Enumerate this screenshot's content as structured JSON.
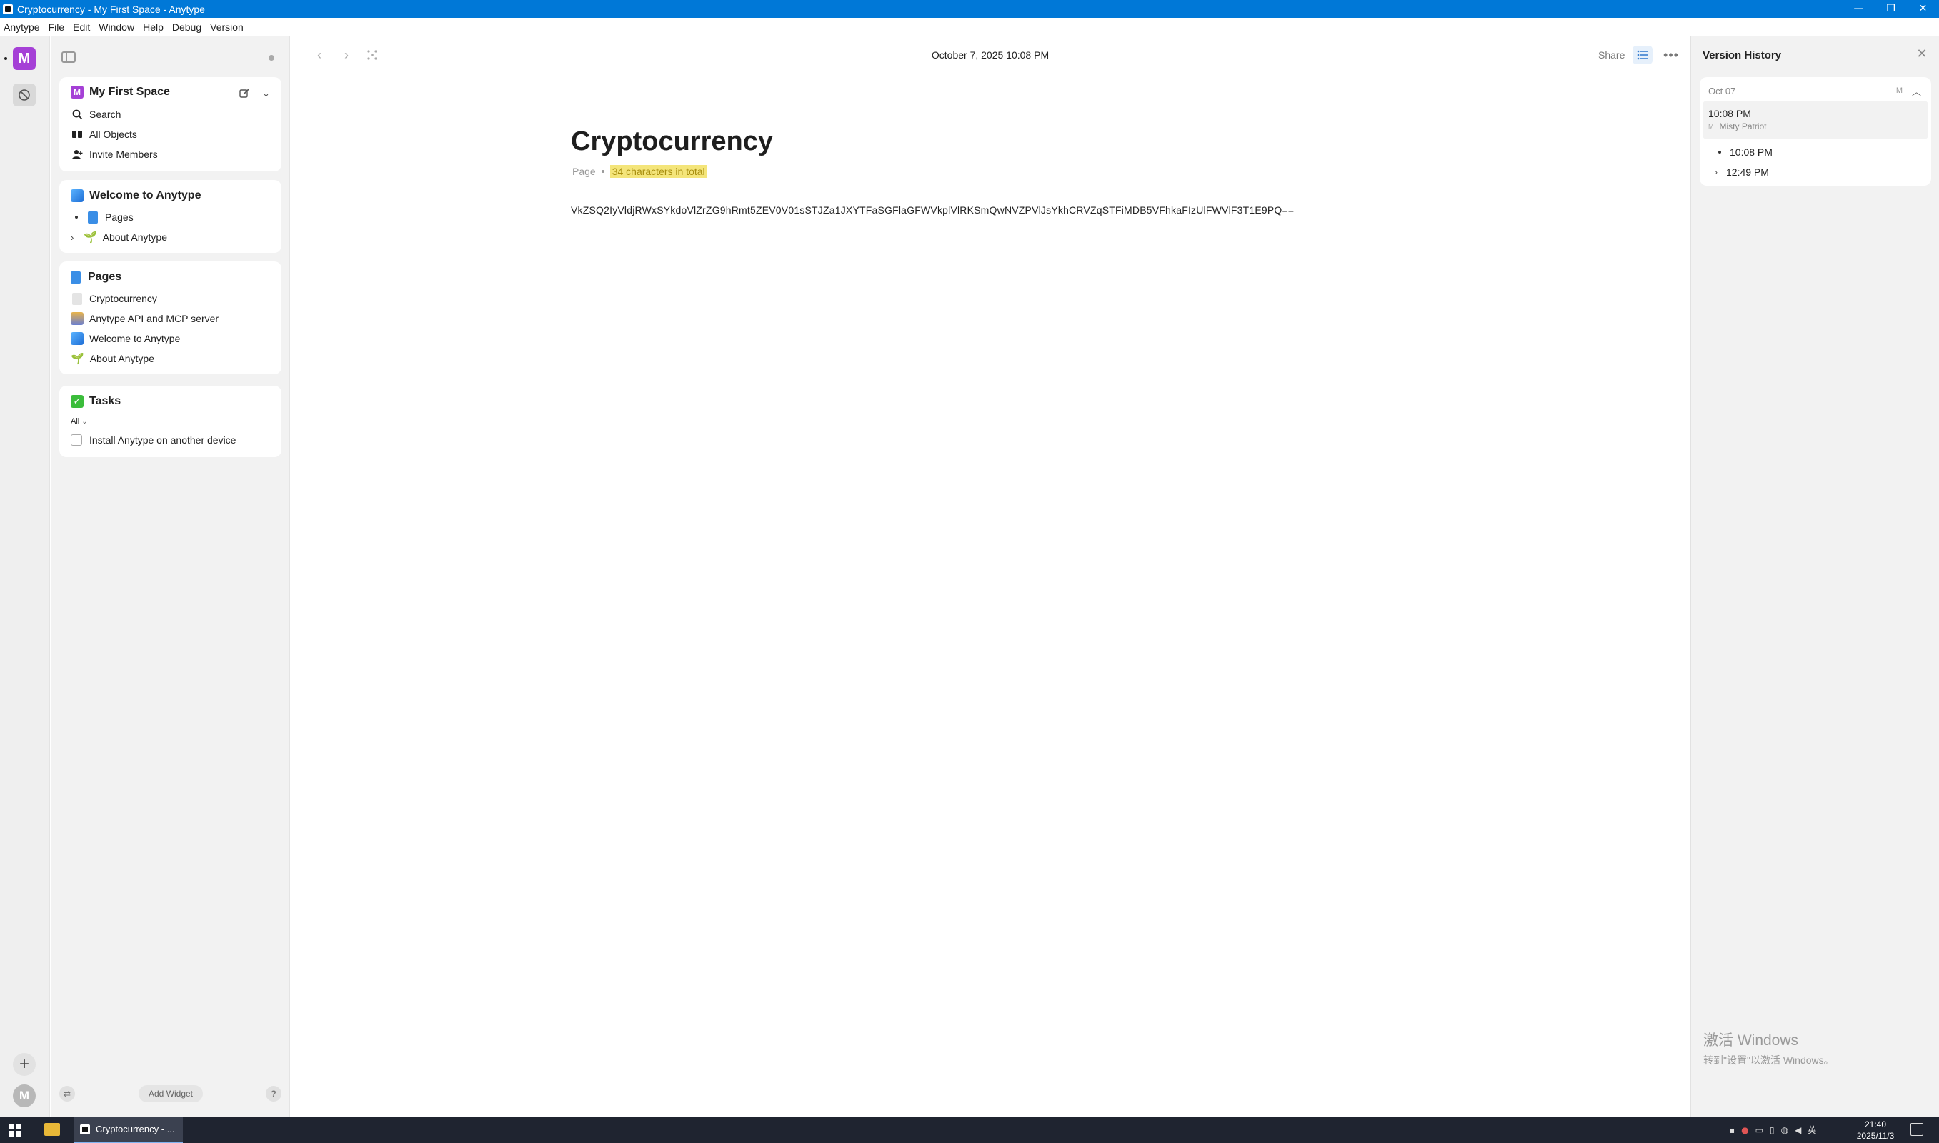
{
  "window": {
    "title": "Cryptocurrency - My First Space - Anytype",
    "controls": {
      "minimize": "—",
      "restore": "❐",
      "close": "✕"
    }
  },
  "menu": [
    "Anytype",
    "File",
    "Edit",
    "Window",
    "Help",
    "Debug",
    "Version"
  ],
  "rail": {
    "space_initial": "M",
    "profile_initial": "M",
    "add": "+",
    "accent": "#a540d6"
  },
  "sidebar": {
    "space": {
      "initial": "M",
      "name": "My First Space",
      "items": [
        {
          "icon": "search-icon",
          "label": "Search"
        },
        {
          "icon": "all-objects-icon",
          "label": "All Objects"
        },
        {
          "icon": "invite-icon",
          "label": "Invite Members"
        }
      ]
    },
    "welcome_widget": {
      "title": "Welcome to Anytype",
      "items": [
        {
          "label": "Pages",
          "expander": "bullet"
        },
        {
          "label": "About Anytype",
          "expander": "chevron"
        }
      ]
    },
    "pages_widget": {
      "title": "Pages",
      "items": [
        {
          "label": "Cryptocurrency",
          "icon": "blank-page-icon"
        },
        {
          "label": "Anytype API and MCP server",
          "icon": "people-icon"
        },
        {
          "label": "Welcome to Anytype",
          "icon": "welcome-icon"
        },
        {
          "label": "About Anytype",
          "icon": "sprout-icon"
        }
      ]
    },
    "tasks_widget": {
      "title": "Tasks",
      "filter": "All",
      "items": [
        {
          "label": "Install Anytype on another device",
          "checked": false
        }
      ]
    },
    "add_widget": "Add Widget",
    "help": "?"
  },
  "header": {
    "date": "October 7, 2025 10:08 PM",
    "share": "Share"
  },
  "document": {
    "title": "Cryptocurrency",
    "type": "Page",
    "chars": "34 characters in total",
    "body": "VkZSQ2IyVldjRWxSYkdoVlZrZG9hRmt5ZEV0V01sSTJZa1JXYTFaSGFlaGFWVkplVlRKSmQwNVZPVlJsYkhCRVZqSTFiMDB5VFhkaFIzUlFWVlF3T1E9PQ=="
  },
  "version_history": {
    "title": "Version History",
    "group": {
      "date": "Oct 07",
      "author_initial": "M",
      "active": {
        "time": "10:08 PM",
        "author": "Misty Patriot",
        "author_initial": "M"
      },
      "items": [
        {
          "time": "10:08 PM",
          "expander": "bullet"
        },
        {
          "time": "12:49 PM",
          "expander": "chevron"
        }
      ]
    }
  },
  "watermark": {
    "line1": "激活 Windows",
    "line2": "转到\"设置\"以激活 Windows。"
  },
  "taskbar": {
    "app_label": "Cryptocurrency - ...",
    "ime": "英",
    "time": "21:40",
    "date": "2025/11/3"
  }
}
